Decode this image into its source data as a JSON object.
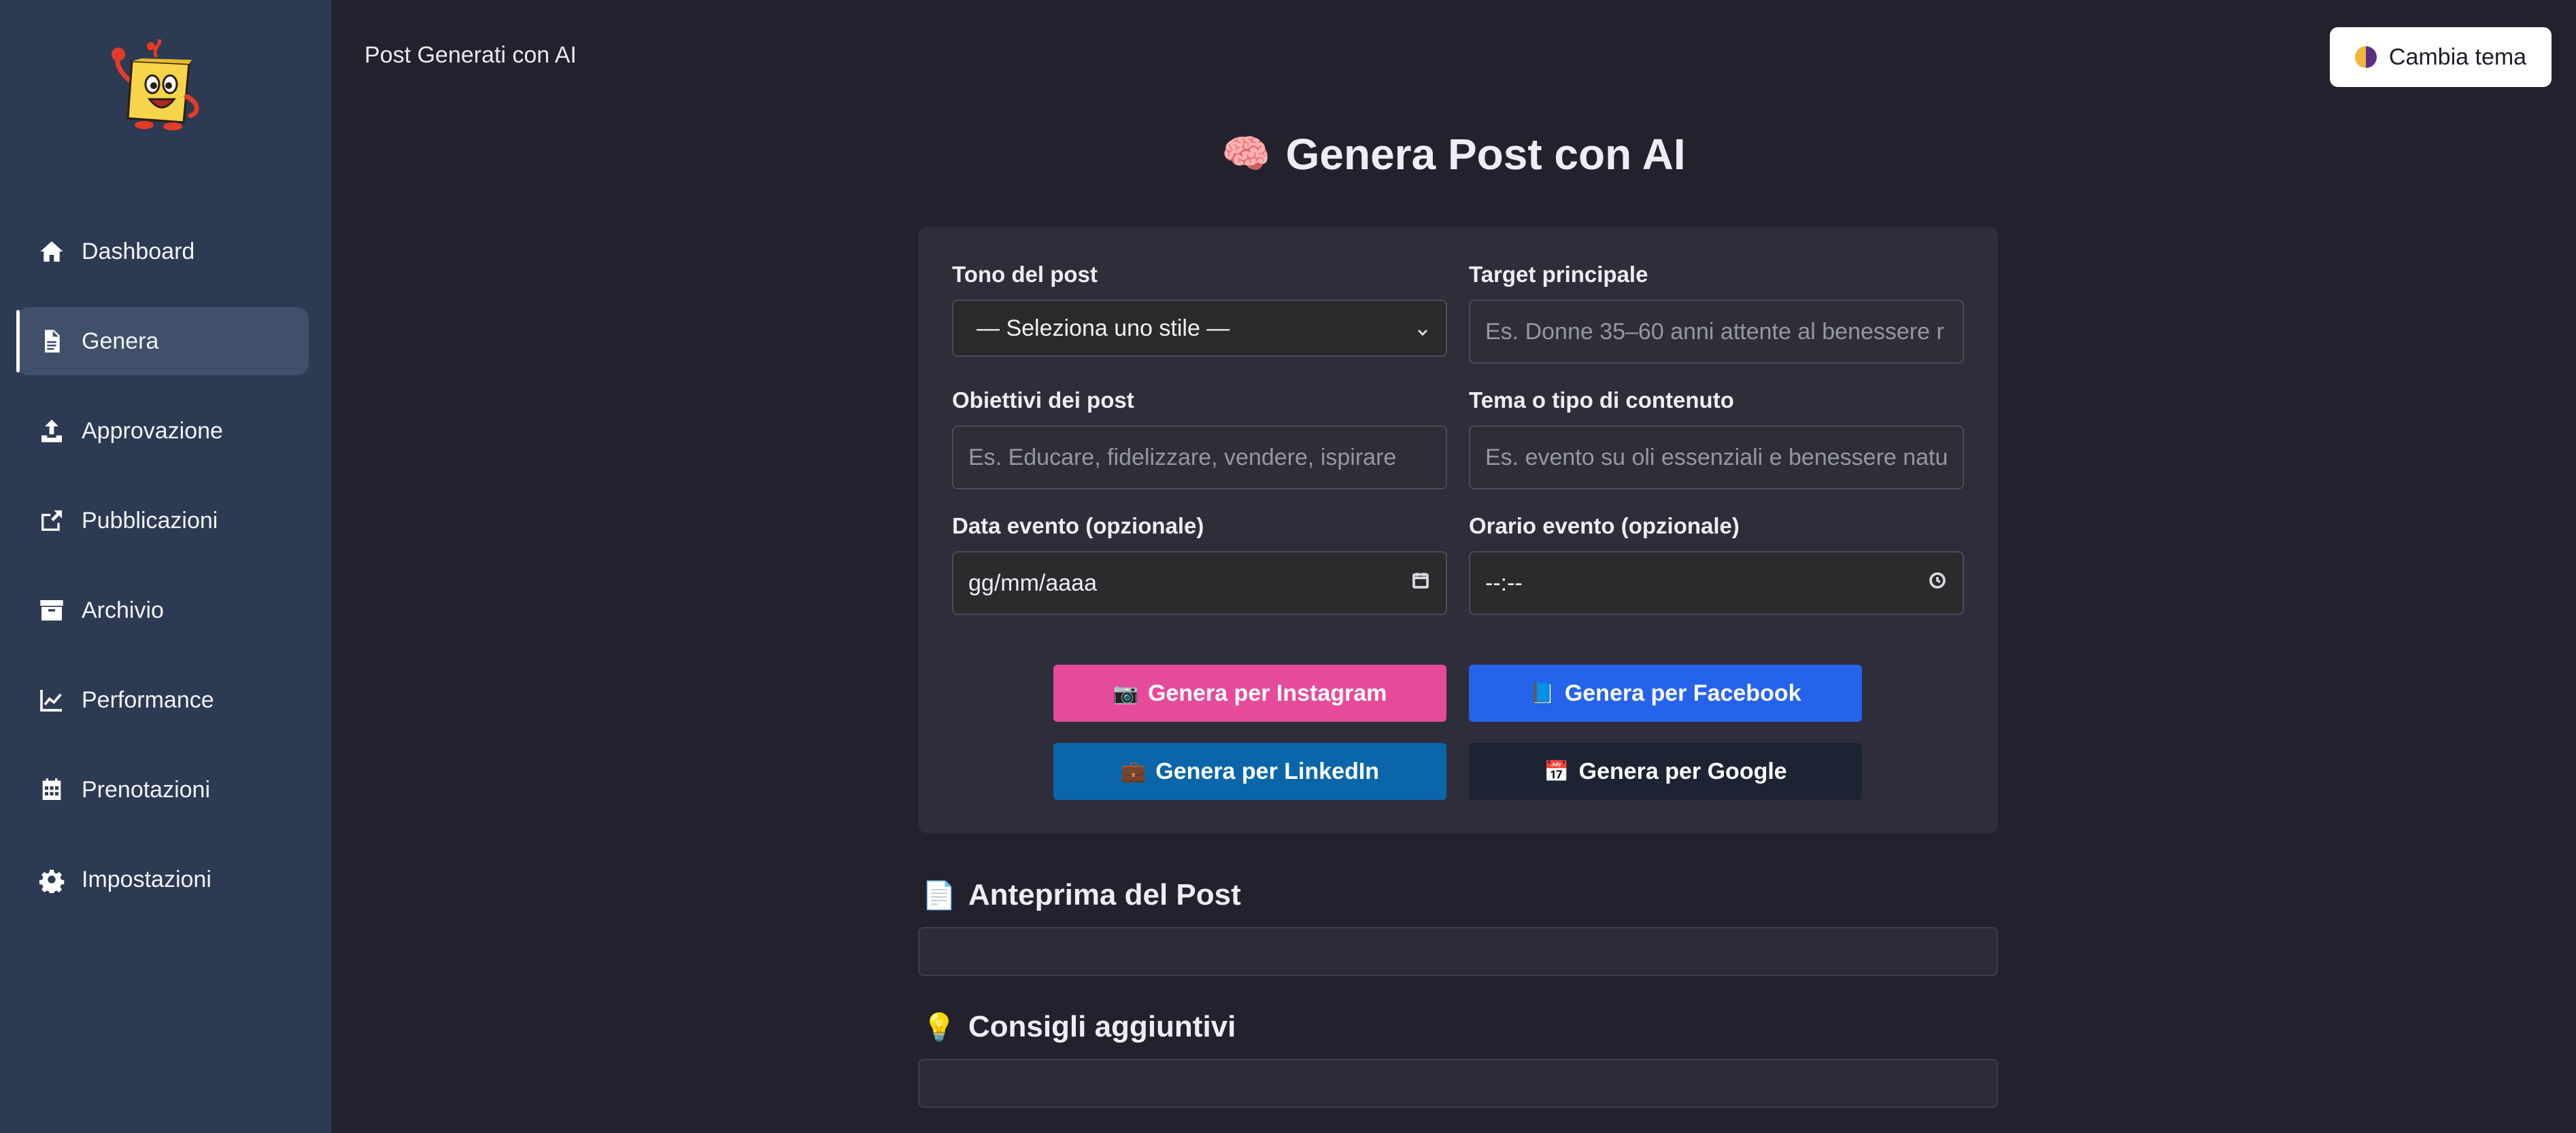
{
  "sidebar": {
    "logo_icon": "smiling-note-mascot",
    "items": [
      {
        "label": "Dashboard",
        "icon": "home-icon"
      },
      {
        "label": "Genera",
        "icon": "document-icon",
        "active": true
      },
      {
        "label": "Approvazione",
        "icon": "upload-icon"
      },
      {
        "label": "Pubblicazioni",
        "icon": "share-icon"
      },
      {
        "label": "Archivio",
        "icon": "archive-icon"
      },
      {
        "label": "Performance",
        "icon": "chart-line-icon"
      },
      {
        "label": "Prenotazioni",
        "icon": "calendar-icon"
      },
      {
        "label": "Impostazioni",
        "icon": "gear-icon"
      }
    ]
  },
  "header": {
    "breadcrumb": "Post Generati con AI",
    "theme_button": "Cambia tema"
  },
  "main": {
    "title_icon": "🧠",
    "title": "Genera Post con AI",
    "form": {
      "tone_label": "Tono del post",
      "tone_value": "— Seleziona uno stile —",
      "target_label": "Target principale",
      "target_placeholder": "Es. Donne 35–60 anni attente al benessere r",
      "goals_label": "Obiettivi dei post",
      "goals_placeholder": "Es. Educare, fidelizzare, vendere, ispirare",
      "theme_label": "Tema o tipo di contenuto",
      "theme_placeholder": "Es. evento su oli essenziali e benessere natu",
      "date_label": "Data evento (opzionale)",
      "date_value": "gg/mm/aaaa",
      "time_label": "Orario evento (opzionale)",
      "time_value": "--:--"
    },
    "buttons": {
      "instagram": {
        "icon": "📷",
        "label": "Genera per Instagram",
        "color": "#e64a9a"
      },
      "facebook": {
        "icon": "📘",
        "label": "Genera per Facebook",
        "color": "#2563eb"
      },
      "linkedin": {
        "icon": "💼",
        "label": "Genera per LinkedIn",
        "color": "#0a66a8"
      },
      "google": {
        "icon": "📅",
        "label": "Genera per Google",
        "color": "#1c2434"
      }
    },
    "preview": {
      "icon": "📄",
      "title": "Anteprima del Post"
    },
    "tips": {
      "icon": "💡",
      "title": "Consigli aggiuntivi"
    }
  }
}
